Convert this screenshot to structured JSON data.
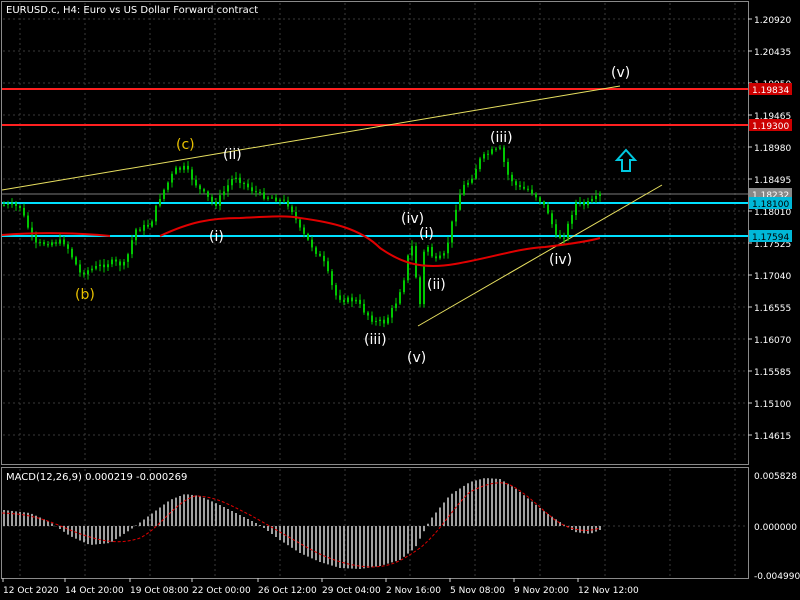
{
  "header": {
    "title": "EURUSD.c, H4:  Euro vs US Dollar Forward contract"
  },
  "macd": {
    "label": "MACD(12,26,9) 0.000219 -0.000269",
    "scale_labels": [
      "0.005828",
      "0.000000",
      "-0.004990"
    ]
  },
  "price_axis": {
    "ticks": [
      "1.20920",
      "1.20435",
      "1.19950",
      "1.19465",
      "1.18980",
      "1.18495",
      "1.18010",
      "1.17525",
      "1.17040",
      "1.16555",
      "1.16070",
      "1.15585",
      "1.15100",
      "1.14615"
    ]
  },
  "time_axis": {
    "labels": [
      "12 Oct 2020",
      "14 Oct 20:00",
      "19 Oct 08:00",
      "22 Oct 00:00",
      "26 Oct 12:00",
      "29 Oct 04:00",
      "2 Nov 16:00",
      "5 Nov 08:00",
      "9 Nov 20:00",
      "12 Nov 12:00"
    ]
  },
  "price_tags": [
    {
      "text": "1.19834",
      "bg": "#cc0000",
      "fg": "#ffffff"
    },
    {
      "text": "1.19300",
      "bg": "#cc0000",
      "fg": "#ffffff"
    },
    {
      "text": "1.18232",
      "bg": "#888888",
      "fg": "#ffffff"
    },
    {
      "text": "1.18100",
      "bg": "#00b8d8",
      "fg": "#000000"
    },
    {
      "text": "1.17594",
      "bg": "#00b8d8",
      "fg": "#000000"
    }
  ],
  "wave_labels": [
    {
      "text": "(c)",
      "color": "#e8c000"
    },
    {
      "text": "(b)",
      "color": "#e8c000"
    },
    {
      "text": "(ii)",
      "color": "#ffffff"
    },
    {
      "text": "(i)",
      "color": "#ffffff"
    },
    {
      "text": "(iii)",
      "color": "#ffffff"
    },
    {
      "text": "(iv)",
      "color": "#ffffff"
    },
    {
      "text": "(v)",
      "color": "#ffffff"
    },
    {
      "text": "(i)",
      "color": "#ffffff"
    },
    {
      "text": "(ii)",
      "color": "#ffffff"
    },
    {
      "text": "(iii)",
      "color": "#ffffff"
    },
    {
      "text": "(iv)",
      "color": "#ffffff"
    },
    {
      "text": "(v)",
      "color": "#ffffff"
    }
  ],
  "colors": {
    "background": "#000000",
    "grid": "#3a3a3a",
    "candles": "#00c800",
    "resistance": "#ff2020",
    "support": "#00e0ff",
    "trendline": "#e8e060",
    "moving_average": "#e00000",
    "macd_bars": "#c8c8c8",
    "macd_signal": "#e00000",
    "arrow": "#00c8e0"
  },
  "icons": {
    "signal_arrow": "up-arrow-icon"
  }
}
